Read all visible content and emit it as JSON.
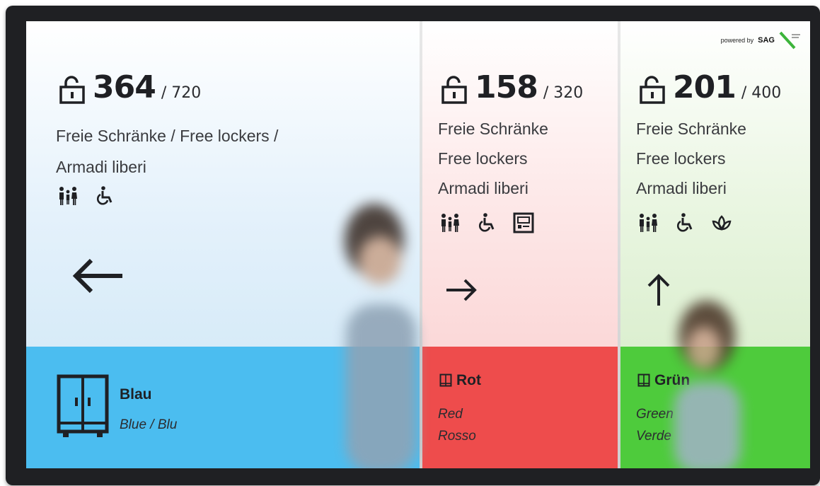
{
  "panels": [
    {
      "id": "blue",
      "free": "364",
      "total": "/ 720",
      "labels": [
        "Freie Schränke / Free lockers /",
        "Armadi liberi"
      ],
      "amenities": [
        "family-icon",
        "wheelchair-icon"
      ],
      "direction": "left-arrow-icon",
      "zone_title": "Blau",
      "zone_subtitle": [
        "Blue / Blu"
      ],
      "accent": "#4bbdf0"
    },
    {
      "id": "red",
      "free": "158",
      "total": "/ 320",
      "labels": [
        "Freie Schränke",
        "Free lockers",
        "Armadi liberi"
      ],
      "amenities": [
        "family-icon",
        "wheelchair-icon",
        "screen-icon"
      ],
      "direction": "right-arrow-icon",
      "zone_title": "Rot",
      "zone_subtitle": [
        "Red",
        "Rosso"
      ],
      "accent": "#ee4c4c"
    },
    {
      "id": "green",
      "free": "201",
      "total": "/ 400",
      "labels": [
        "Freie Schränke",
        "Free lockers",
        "Armadi liberi"
      ],
      "amenities": [
        "family-icon",
        "wheelchair-icon",
        "lotus-icon"
      ],
      "direction": "up-arrow-icon",
      "zone_title": "Grün",
      "zone_subtitle": [
        "Green",
        "Verde"
      ],
      "accent": "#4ecb3c"
    }
  ],
  "branding": {
    "powered_by": "powered by",
    "brand": "SAG"
  }
}
